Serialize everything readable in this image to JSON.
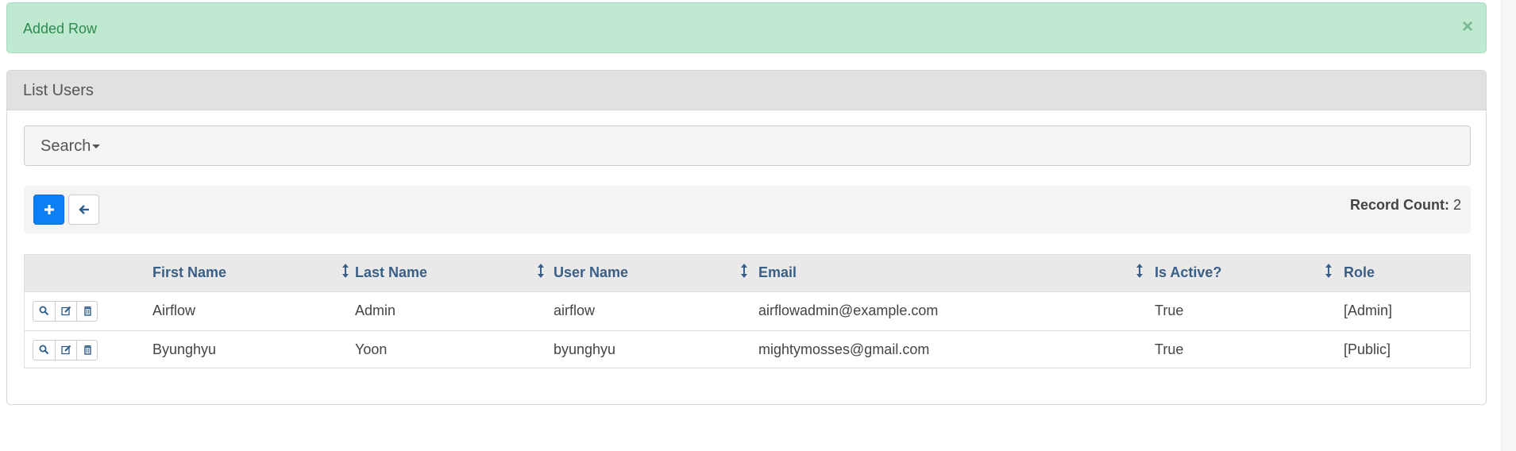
{
  "alert": {
    "text": "Added Row",
    "close": "×"
  },
  "panel": {
    "title": "List Users"
  },
  "search": {
    "label": "Search"
  },
  "toolbar": {
    "record_count_label": "Record Count:",
    "record_count_value": "2"
  },
  "table": {
    "columns": [
      "First Name",
      "Last Name",
      "User Name",
      "Email",
      "Is Active?",
      "Role"
    ],
    "rows": [
      [
        "Airflow",
        "Admin",
        "airflow",
        "airflowadmin@example.com",
        "True",
        "[Admin]"
      ],
      [
        "Byunghyu",
        "Yoon",
        "byunghyu",
        "mightymosses@gmail.com",
        "True",
        "[Public]"
      ]
    ]
  },
  "colors": {
    "alert_bg": "#bfe9d1",
    "primary": "#0d7ff5",
    "header_text": "#3a5f86"
  },
  "icons": [
    "close-icon",
    "plus-icon",
    "arrow-left-icon",
    "sort-icon",
    "search-icon",
    "edit-icon",
    "trash-icon"
  ]
}
